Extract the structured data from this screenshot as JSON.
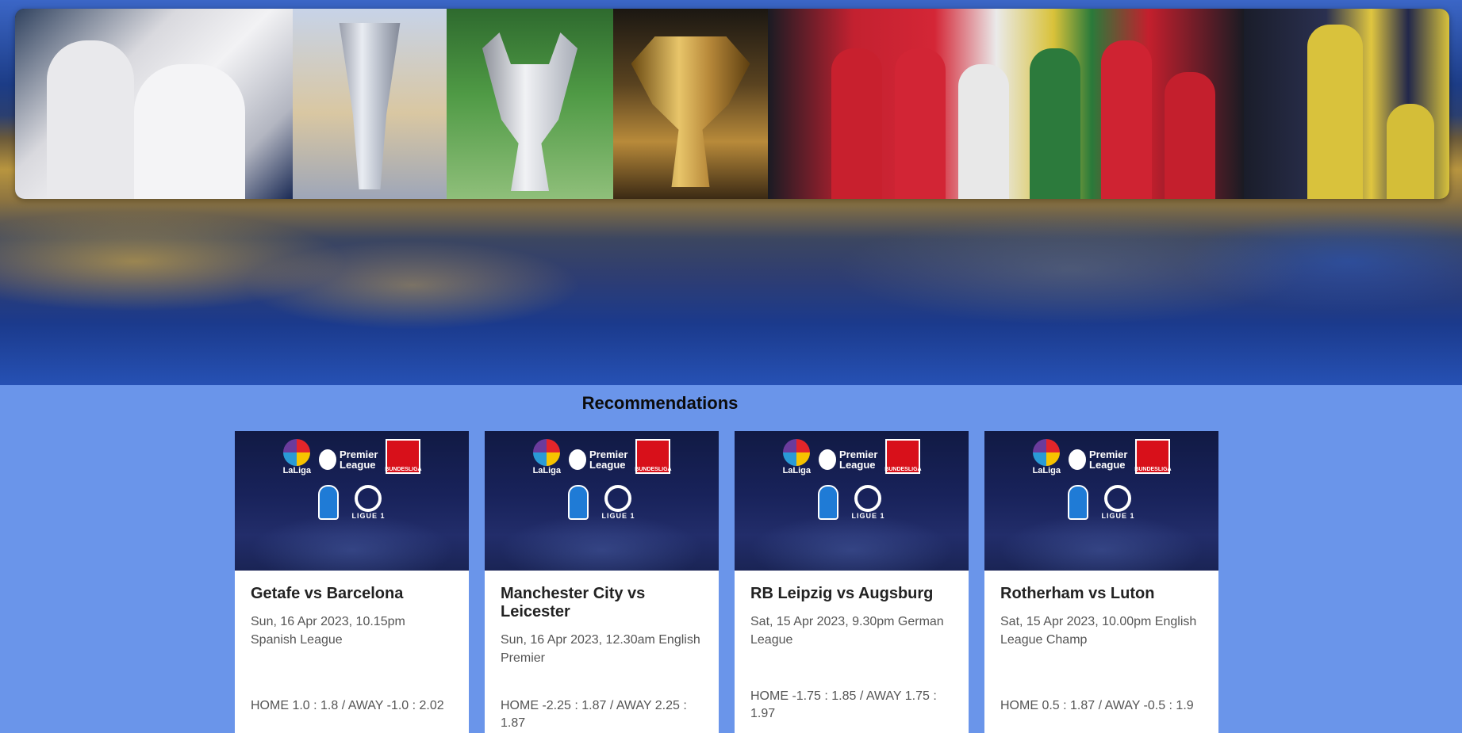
{
  "page": {
    "section_title": "Recommendations"
  },
  "banner": {
    "tiles": [
      "photo-celebration",
      "trophy-europa",
      "trophy-champions-league",
      "trophy-gold",
      "photo-arsenal-team",
      "photo-player"
    ]
  },
  "cards": [
    {
      "match": "Getafe vs Barcelona",
      "meta": "Sun, 16 Apr 2023, 10.15pm Spanish League",
      "odds": "HOME 1.0 : 1.8 / AWAY -1.0 : 2.02"
    },
    {
      "match": "Manchester City vs Leicester",
      "meta": "Sun, 16 Apr 2023, 12.30am English Premier",
      "odds": "HOME -2.25 : 1.87 / AWAY 2.25 : 1.87"
    },
    {
      "match": "RB Leipzig vs Augsburg",
      "meta": "Sat, 15 Apr 2023, 9.30pm German League",
      "odds": "HOME -1.75 : 1.85 / AWAY 1.75 : 1.97"
    },
    {
      "match": "Rotherham vs Luton",
      "meta": "Sat, 15 Apr 2023, 10.00pm English League Champ",
      "odds": "HOME 0.5 : 1.87 / AWAY -0.5 : 1.9"
    }
  ],
  "league_logos": {
    "laliga": "LaLiga",
    "premier_line1": "Premier",
    "premier_line2": "League",
    "bundesliga": "BUNDESLIGA",
    "ligue1": "LIGUE 1"
  },
  "colors": {
    "page_bg": "#6a95ea",
    "card_bg": "#ffffff",
    "card_image_bg": "#18225a"
  }
}
